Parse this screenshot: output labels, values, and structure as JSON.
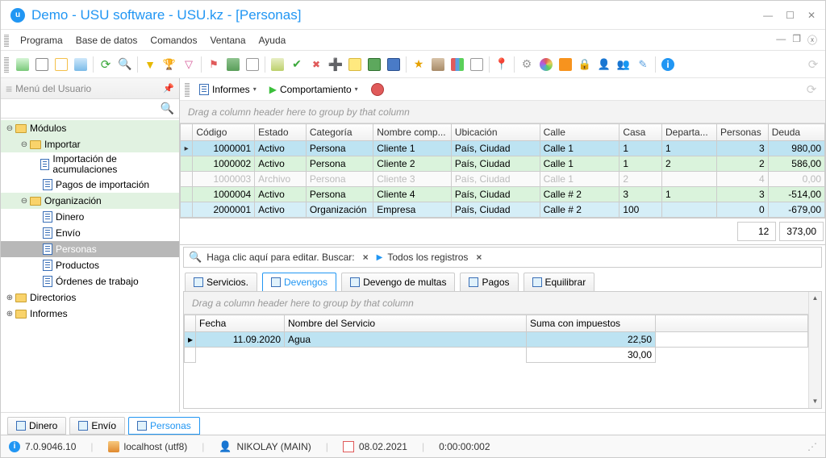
{
  "title": "Demo - USU software - USU.kz - [Personas]",
  "menu": [
    "Programa",
    "Base de datos",
    "Comandos",
    "Ventana",
    "Ayuda"
  ],
  "sidebar": {
    "title": "Menú del Usuario",
    "nodes": {
      "modulos": "Módulos",
      "importar": "Importar",
      "imp_acum": "Importación de acumulaciones",
      "imp_pagos": "Pagos de importación",
      "organizacion": "Organización",
      "dinero": "Dinero",
      "envio": "Envío",
      "personas": "Personas",
      "productos": "Productos",
      "ordenes": "Órdenes de trabajo",
      "directorios": "Directorios",
      "informes": "Informes"
    }
  },
  "contentToolbar": {
    "informes": "Informes",
    "comportamiento": "Comportamiento"
  },
  "groupPrompt": "Drag a column header here to group by that column",
  "grid": {
    "columns": [
      "Código",
      "Estado",
      "Categoría",
      "Nombre comp...",
      "Ubicación",
      "Calle",
      "Casa",
      "Departa...",
      "Personas",
      "Deuda"
    ],
    "rows": [
      {
        "codigo": "1000001",
        "estado": "Activo",
        "cat": "Persona",
        "nombre": "Cliente 1",
        "ubic": "País, Ciudad",
        "calle": "Calle 1",
        "casa": "1",
        "dept": "1",
        "pers": "3",
        "deuda": "980,00",
        "class": "blue",
        "sel": true
      },
      {
        "codigo": "1000002",
        "estado": "Activo",
        "cat": "Persona",
        "nombre": "Cliente 2",
        "ubic": "País, Ciudad",
        "calle": "Calle 1",
        "casa": "1",
        "dept": "2",
        "pers": "2",
        "deuda": "586,00",
        "class": "green"
      },
      {
        "codigo": "1000003",
        "estado": "Archivo",
        "cat": "Persona",
        "nombre": "Cliente 3",
        "ubic": "País, Ciudad",
        "calle": "Calle 1",
        "casa": "2",
        "dept": "",
        "pers": "4",
        "deuda": "0,00",
        "class": "muted"
      },
      {
        "codigo": "1000004",
        "estado": "Activo",
        "cat": "Persona",
        "nombre": "Cliente 4",
        "ubic": "País, Ciudad",
        "calle": "Calle # 2",
        "casa": "3",
        "dept": "1",
        "pers": "3",
        "deuda": "-514,00",
        "class": "green"
      },
      {
        "codigo": "2000001",
        "estado": "Activo",
        "cat": "Organización",
        "nombre": "Empresa",
        "ubic": "País, Ciudad",
        "calle": "Calle # 2",
        "casa": "100",
        "dept": "",
        "pers": "0",
        "deuda": "-679,00",
        "class": "blue"
      }
    ],
    "footer": {
      "pers": "12",
      "deuda": "373,00"
    }
  },
  "filter": {
    "edit": "Haga clic aquí para editar. Buscar:",
    "all": "Todos los registros"
  },
  "detailTabs": [
    "Servicios.",
    "Devengos",
    "Devengo de multas",
    "Pagos",
    "Equilibrar"
  ],
  "detail": {
    "columns": [
      "Fecha",
      "Nombre del Servicio",
      "Suma con impuestos"
    ],
    "row": {
      "fecha": "11.09.2020",
      "nombre": "Agua",
      "suma": "22,50"
    },
    "footer": "30,00"
  },
  "wsTabs": [
    "Dinero",
    "Envío",
    "Personas"
  ],
  "status": {
    "version": "7.0.9046.10",
    "host": "localhost (utf8)",
    "user": "NIKOLAY (MAIN)",
    "date": "08.02.2021",
    "time": "0:00:00:002"
  }
}
